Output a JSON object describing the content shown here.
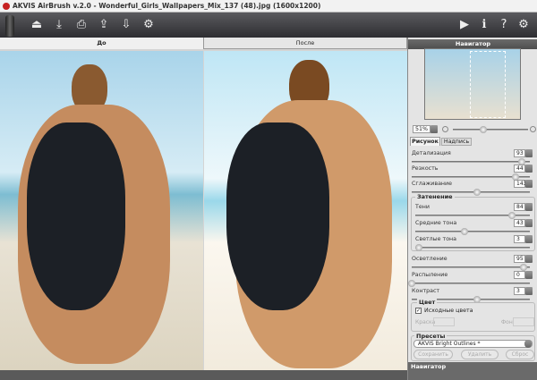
{
  "window": {
    "title": "AKVIS AirBrush v.2.0 - Wonderful_Girls_Wallpapers_Mix_137 (48).jpg (1600x1200)"
  },
  "toolbar": {
    "left": [
      "airbrush-icon",
      "open-icon",
      "save-icon",
      "print-icon",
      "import-preset-icon",
      "export-preset-icon",
      "settings-gears-icon"
    ],
    "right": [
      "run-icon",
      "info-icon",
      "help-icon",
      "preferences-icon"
    ]
  },
  "view_tabs": {
    "before": "До",
    "after": "После"
  },
  "navigator": {
    "title": "Навигатор",
    "zoom": "51%"
  },
  "settings_tabs": {
    "drawing": "Рисунок",
    "caption": "Надпись"
  },
  "params": [
    {
      "label": "Детализация",
      "value": "93",
      "level": 0.93
    },
    {
      "label": "Резкость",
      "value": "44",
      "level": 0.88
    },
    {
      "label": "Сглаживание",
      "value": "143",
      "level": 0.55
    }
  ],
  "shading": {
    "title": "Затенение",
    "params": [
      {
        "label": "Тени",
        "value": "84",
        "level": 0.84
      },
      {
        "label": "Средние тона",
        "value": "43",
        "level": 0.43
      },
      {
        "label": "Светлые тона",
        "value": "3",
        "level": 0.03
      }
    ]
  },
  "params2": [
    {
      "label": "Осветление",
      "value": "95",
      "level": 0.95
    },
    {
      "label": "Распыление",
      "value": "0",
      "level": 0.0
    },
    {
      "label": "Контраст",
      "value": "3",
      "level": 0.55
    }
  ],
  "color": {
    "title": "Цвет",
    "original_colors": "Исходные цвета",
    "original_checked": true,
    "paint": "Краска",
    "background": "Фон"
  },
  "presets": {
    "title": "Пресеты",
    "selected": "AKVIS Bright Outlines *",
    "save": "Сохранить",
    "delete": "Удалить",
    "reset": "Сброс"
  },
  "bottom": {
    "title": "Навигатор"
  }
}
